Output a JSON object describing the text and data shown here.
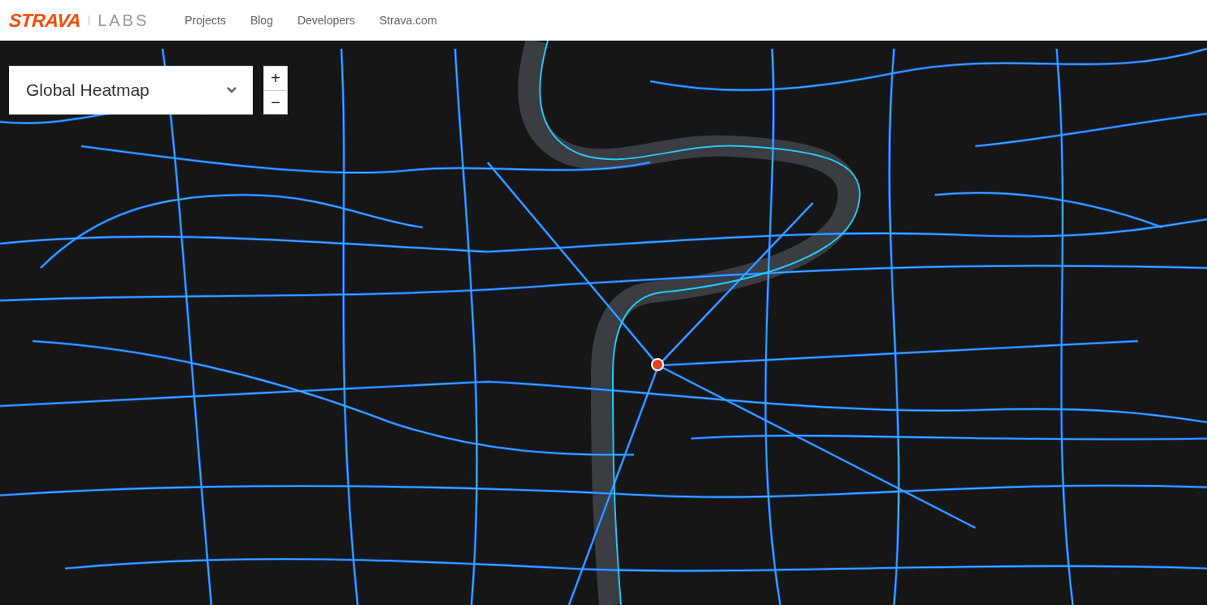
{
  "header": {
    "logo": "STRAVA",
    "logo_suffix": "LABS",
    "nav": [
      "Projects",
      "Blog",
      "Developers",
      "Strava.com"
    ]
  },
  "map": {
    "layer_select": {
      "value": "Global Heatmap"
    },
    "zoom_in": "+",
    "zoom_out": "−"
  }
}
